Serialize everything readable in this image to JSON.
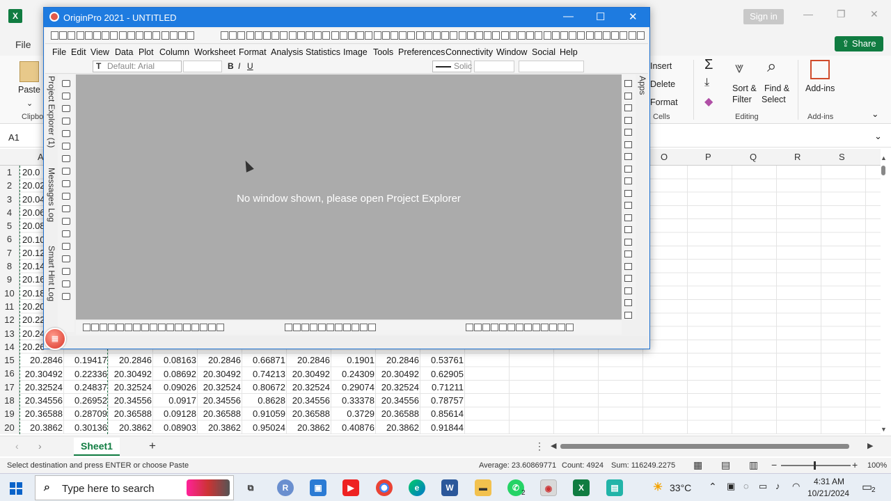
{
  "excel": {
    "file_label": "File",
    "signin_label": "Sign in",
    "share_label": "Share",
    "ribbon": {
      "paste_label": "Paste",
      "clipboard_group": "Clipbo",
      "insert_label": "Insert",
      "delete_label": "Delete",
      "format_label": "Format",
      "cells_group": "Cells",
      "sort_filter_label": "Sort &",
      "sort_filter_label2": "Filter",
      "find_select_label": "Find &",
      "find_select_label2": "Select",
      "editing_group": "Editing",
      "addins_label": "Add-ins",
      "addins_group": "Add-ins"
    },
    "name_box": "A1",
    "columns": [
      "A",
      "O",
      "P",
      "Q",
      "R",
      "S"
    ],
    "row_numbers": [
      "1",
      "2",
      "3",
      "4",
      "5",
      "6",
      "7",
      "8",
      "9",
      "10",
      "11",
      "12",
      "13",
      "14",
      "15",
      "16",
      "17",
      "18",
      "19",
      "20"
    ],
    "partial_col_a": [
      "20.0",
      "20.02",
      "20.04",
      "20.06",
      "20.08",
      "20.10",
      "20.12",
      "20.14",
      "20.16",
      "20.18",
      "20.20",
      "20.22",
      "20.24",
      "20.26"
    ],
    "rows": [
      {
        "n": "15",
        "cells": [
          "20.2846",
          "0.19417",
          "20.2846",
          "0.08163",
          "20.2846",
          "0.66871",
          "20.2846",
          "0.1901",
          "20.2846",
          "0.53761"
        ]
      },
      {
        "n": "16",
        "cells": [
          "20.30492",
          "0.22336",
          "20.30492",
          "0.08692",
          "20.30492",
          "0.74213",
          "20.30492",
          "0.24309",
          "20.30492",
          "0.62905"
        ]
      },
      {
        "n": "17",
        "cells": [
          "20.32524",
          "0.24837",
          "20.32524",
          "0.09026",
          "20.32524",
          "0.80672",
          "20.32524",
          "0.29074",
          "20.32524",
          "0.71211"
        ]
      },
      {
        "n": "18",
        "cells": [
          "20.34556",
          "0.26952",
          "20.34556",
          "0.0917",
          "20.34556",
          "0.8628",
          "20.34556",
          "0.33378",
          "20.34556",
          "0.78757"
        ]
      },
      {
        "n": "19",
        "cells": [
          "20.36588",
          "0.28709",
          "20.36588",
          "0.09128",
          "20.36588",
          "0.91059",
          "20.36588",
          "0.3729",
          "20.36588",
          "0.85614"
        ]
      },
      {
        "n": "20",
        "cells": [
          "20.3862",
          "0.30136",
          "20.3862",
          "0.08903",
          "20.3862",
          "0.95024",
          "20.3862",
          "0.40876",
          "20.3862",
          "0.91844"
        ]
      }
    ],
    "sheet_tab": "Sheet1",
    "add_sheet": "+",
    "status_message": "Select destination and press ENTER or choose Paste",
    "average": "Average: 23.60869771",
    "count": "Count: 4924",
    "sum": "Sum: 116249.2275",
    "zoom": "100%"
  },
  "origin": {
    "title": "OriginPro 2021 - UNTITLED",
    "menu": [
      "File",
      "Edit",
      "View",
      "Data",
      "Plot",
      "Column",
      "Worksheet",
      "Format",
      "Analysis",
      "Statistics",
      "Image",
      "Tools",
      "Preferences",
      "Connectivity",
      "Window",
      "Social",
      "Help"
    ],
    "font_placeholder": "Default: Arial",
    "line_style": "Solic",
    "side_tabs": [
      "Project Explorer (1)",
      "Messages Log",
      "Smart Hint Log"
    ],
    "apps_tab": "Apps",
    "workspace_message": "No window shown, please open Project Explorer"
  },
  "taskbar": {
    "search_placeholder": "Type here to search",
    "weather": "33°C",
    "time": "4:31 AM",
    "date": "10/21/2024",
    "notifications": "2",
    "whatsapp_badge": "2"
  }
}
